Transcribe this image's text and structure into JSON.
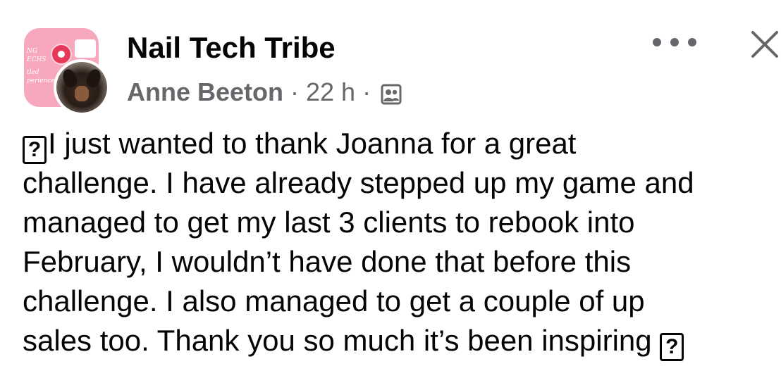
{
  "post": {
    "group_name": "Nail Tech Tribe",
    "author": "Anne Beeton",
    "separator": "·",
    "time": "22 h",
    "privacy_icon": "group-members-icon",
    "group_avatar_text": [
      "NG",
      "ECHS",
      "tled",
      "perience!"
    ],
    "text_lines": [
      "I just wanted to thank Joanna for a great",
      "challenge. I have already stepped up my game and",
      "managed to get my last 3 clients to rebook into",
      "February, I wouldn’t have done that before this",
      "challenge. I also managed to get a couple of up",
      "sales too. Thank you so much it’s been inspiring"
    ],
    "emoji_placeholder": "?"
  },
  "actions": {
    "more_icon": "more-dots-icon",
    "close_icon": "close-icon"
  },
  "colors": {
    "text": "#050505",
    "secondary": "#65676b",
    "group_avatar_bg": "#f7a8bd"
  }
}
